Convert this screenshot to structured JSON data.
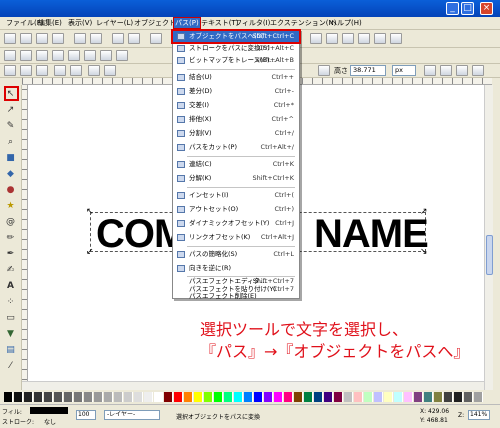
{
  "window": {
    "title": "",
    "buttons": [
      "_",
      "□",
      "×"
    ]
  },
  "menubar": [
    "ファイル(F)",
    "編集(E)",
    "表示(V)",
    "レイヤー(L)",
    "オブジェクト(O)",
    "パス(P)",
    "テキスト(T)",
    "フィルタ(I)",
    "エクステンション(N)",
    "ヘルプ(H)"
  ],
  "menu": {
    "items": [
      {
        "label": "オブジェクトをパスへ(O)",
        "shortcut": "Shift+Ctrl+C",
        "highlighted": true
      },
      {
        "label": "ストロークをパスに変換(S)",
        "shortcut": "Ctrl+Alt+C"
      },
      {
        "label": "ビットマップをトレース(B)...",
        "shortcut": "Shift+Alt+B"
      },
      {
        "label": "結合(U)",
        "shortcut": "Ctrl++"
      },
      {
        "label": "差分(D)",
        "shortcut": "Ctrl+-"
      },
      {
        "label": "交差(I)",
        "shortcut": "Ctrl+*"
      },
      {
        "label": "排他(X)",
        "shortcut": "Ctrl+^"
      },
      {
        "label": "分割(V)",
        "shortcut": "Ctrl+/"
      },
      {
        "label": "パスをカット(P)",
        "shortcut": "Ctrl+Alt+/"
      },
      {
        "label": "連結(C)",
        "shortcut": "Ctrl+K"
      },
      {
        "label": "分解(K)",
        "shortcut": "Shift+Ctrl+K"
      },
      {
        "label": "インセット(I)",
        "shortcut": "Ctrl+("
      },
      {
        "label": "アウトセット(O)",
        "shortcut": "Ctrl+)"
      },
      {
        "label": "ダイナミックオフセット(Y)",
        "shortcut": "Ctrl+J"
      },
      {
        "label": "リンクオフセット(K)",
        "shortcut": "Ctrl+Alt+J"
      },
      {
        "label": "パスの簡略化(S)",
        "shortcut": "Ctrl+L"
      },
      {
        "label": "向きを逆に(R)",
        "shortcut": ""
      },
      {
        "label": "パスエフェクトエディタ...",
        "shortcut": "Shift+Ctrl+7"
      },
      {
        "label": "パスエフェクトを貼り付け(Y)",
        "shortcut": "Ctrl+7"
      },
      {
        "label": "パスエフェクト削除(E)",
        "shortcut": ""
      }
    ]
  },
  "canvas": {
    "left_text": "COM",
    "right_text": "NAME"
  },
  "caption": {
    "line1": "選択ツールで文字を選択し、",
    "line2": "『パス』→『オブジェクトをパスへ』"
  },
  "toolbar2": {
    "label_h": "高さ",
    "value_h": "38.771",
    "unit": "px"
  },
  "status": {
    "fill_label": "フィル:",
    "stroke_label": "ストローク:",
    "stroke_value": "なし",
    "opacity": "100",
    "layer": "-レイヤー-",
    "message": "選択オブジェクトをパスに変換",
    "x": "X: 429.06",
    "y": "Y: 468.81",
    "zoom": "141%",
    "z_label": "Z:"
  },
  "colors": {
    "titlebar": "#0443b8",
    "highlight": "#316ac5",
    "accent_red": "#dd0000"
  }
}
